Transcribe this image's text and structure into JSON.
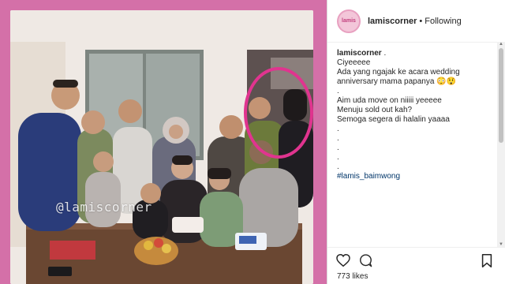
{
  "post": {
    "watermark": "@lamiscorner"
  },
  "header": {
    "avatar_text": "lamis",
    "username": "lamiscorner",
    "separator": "•",
    "follow_status": "Following"
  },
  "caption": {
    "username": "lamiscorner",
    "username_suffix": " .",
    "lines": [
      "Ciyeeeee",
      "Ada yang ngajak ke acara wedding",
      "anniversary mama papanya 😳😲",
      ".",
      "Aim uda move on niiiii yeeeee",
      "Menuju sold out kah?",
      "Semoga segera di halalin yaaaa",
      ".",
      ".",
      ".",
      ".",
      "."
    ],
    "hashtag": "#lamis_baimwong"
  },
  "actions": {
    "likes": "773 likes"
  },
  "icons": {
    "like": "heart-icon",
    "comment": "comment-icon",
    "save": "bookmark-icon"
  },
  "colors": {
    "frame": "#d470a8",
    "highlight_circle": "#e0348f"
  }
}
